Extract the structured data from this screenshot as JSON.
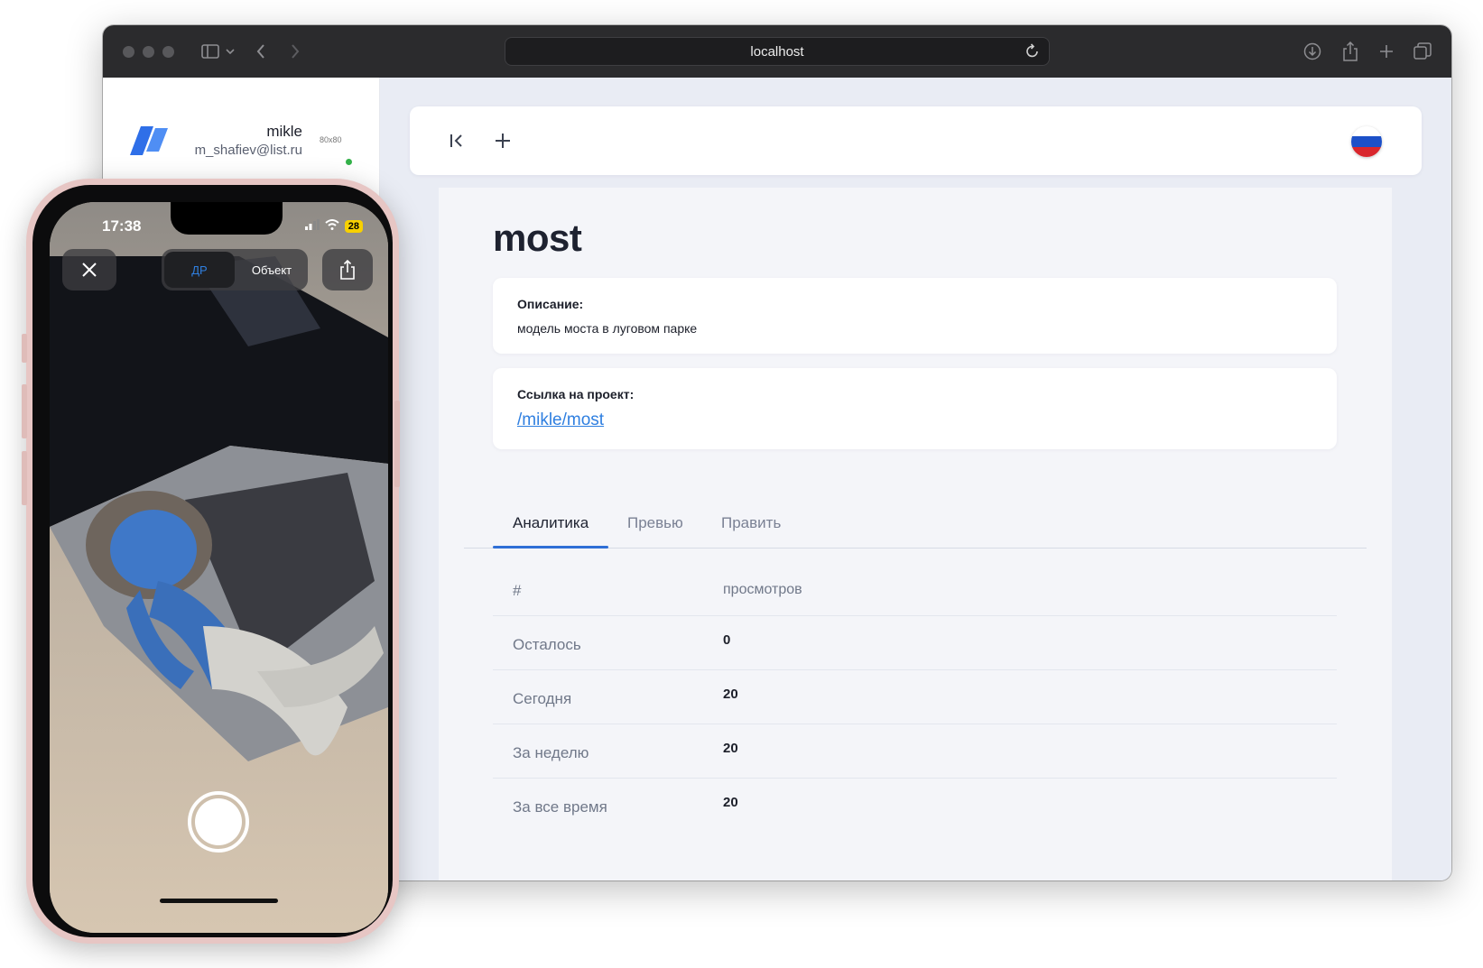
{
  "browser": {
    "address": "localhost",
    "icons": [
      "sidebar-icon",
      "chevron-down-icon",
      "back-icon",
      "forward-icon",
      "reload-icon",
      "download-icon",
      "share-icon",
      "new-tab-icon",
      "tabs-overview-icon"
    ]
  },
  "sidebar": {
    "user_name": "mikle",
    "user_email": "m_shafiev@list.ru",
    "avatar_placeholder": "80x80"
  },
  "topbar": {
    "icons": [
      "collapse-sidebar-icon",
      "add-icon"
    ],
    "language_flag": "russian-flag-icon"
  },
  "page": {
    "title": "most",
    "description_label": "Описание:",
    "description_text": "модель моста в луговом парке",
    "link_label": "Ссылка на проект:",
    "link_text": "/mikle/most"
  },
  "tabs": [
    {
      "label": "Аналитика",
      "active": true
    },
    {
      "label": "Превью",
      "active": false
    },
    {
      "label": "Править",
      "active": false
    }
  ],
  "table": {
    "headers": [
      "#",
      "просмотров"
    ],
    "rows": [
      [
        "Осталось",
        "0"
      ],
      [
        "Сегодня",
        "20"
      ],
      [
        "За неделю",
        "20"
      ],
      [
        "За все время",
        "20"
      ]
    ]
  },
  "phone": {
    "time": "17:38",
    "battery": "28",
    "mode_ar": "ДР",
    "mode_object": "Объект",
    "icons": [
      "close-icon",
      "share-icon",
      "shutter-button"
    ]
  },
  "colors": {
    "accent": "#2f6fd6",
    "link": "#2f7fe0",
    "online": "#34b24a",
    "titlebar": "#2b2b2d"
  }
}
